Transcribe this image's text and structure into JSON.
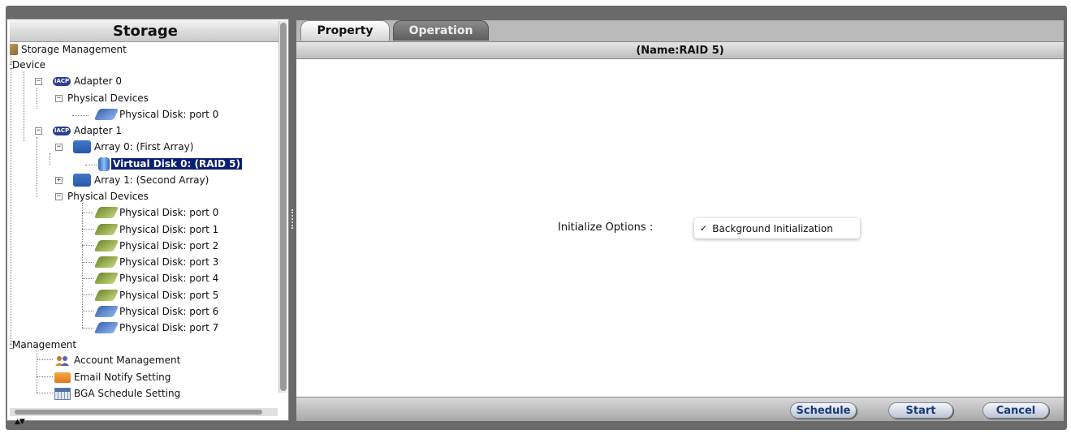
{
  "left_panel": {
    "title": "Storage",
    "tree": {
      "root": "Storage Management",
      "device": "Device",
      "adapter0": "Adapter 0",
      "adapter0_physical_devices": "Physical Devices",
      "adapter0_disk0": "Physical Disk: port 0",
      "adapter1": "Adapter 1",
      "array0": "Array 0: (First Array)",
      "virtual_disk0": "Virtual Disk 0: (RAID 5)",
      "array1": "Array 1: (Second Array)",
      "adapter1_physical_devices": "Physical Devices",
      "disks": [
        "Physical Disk: port 0",
        "Physical Disk: port 1",
        "Physical Disk: port 2",
        "Physical Disk: port 3",
        "Physical Disk: port 4",
        "Physical Disk: port 5",
        "Physical Disk: port 6",
        "Physical Disk: port 7"
      ],
      "management": "Management",
      "account_management": "Account Management",
      "email_notify": "Email Notify Setting",
      "bga_schedule": "BGA Schedule Setting"
    },
    "adapter_icon_text": "IACP"
  },
  "tabs": {
    "property": "Property",
    "operation": "Operation"
  },
  "header": {
    "name": "(Name:RAID 5)"
  },
  "operation": {
    "initialize_label": "Initialize Options :",
    "initialize_option": "Background Initialization",
    "initialize_check": "✓"
  },
  "buttons": {
    "schedule": "Schedule",
    "start": "Start",
    "cancel": "Cancel"
  },
  "colors": {
    "selection": "#0a1f6e",
    "button_text": "#1a3b7a",
    "frame": "#6a6a6a"
  }
}
